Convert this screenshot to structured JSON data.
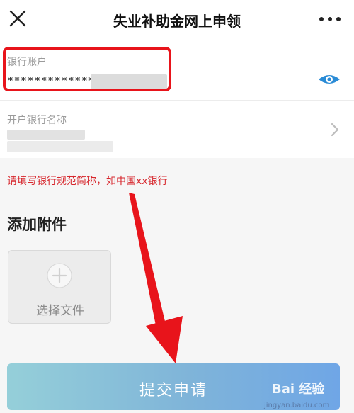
{
  "navbar": {
    "title": "失业补助金网上申领"
  },
  "form": {
    "account_label": "银行账户",
    "account_value_masked": "*************",
    "bank_label": "开户银行名称",
    "hint": "请填写银行规范简称，如中国xx银行"
  },
  "attachments": {
    "title": "添加附件",
    "upload_label": "选择文件"
  },
  "submit": {
    "label": "提交申请"
  },
  "watermark": {
    "brand": "Bai 经验",
    "url": "jingyan.baidu.com"
  },
  "colors": {
    "highlight": "#e8141b",
    "hint": "#d7272d",
    "eye": "#2a8bd6"
  },
  "icons": {
    "close": "close-icon",
    "more": "more-icon",
    "eye": "eye-icon",
    "chevron": "chevron-right-icon",
    "plus": "plus-icon"
  }
}
